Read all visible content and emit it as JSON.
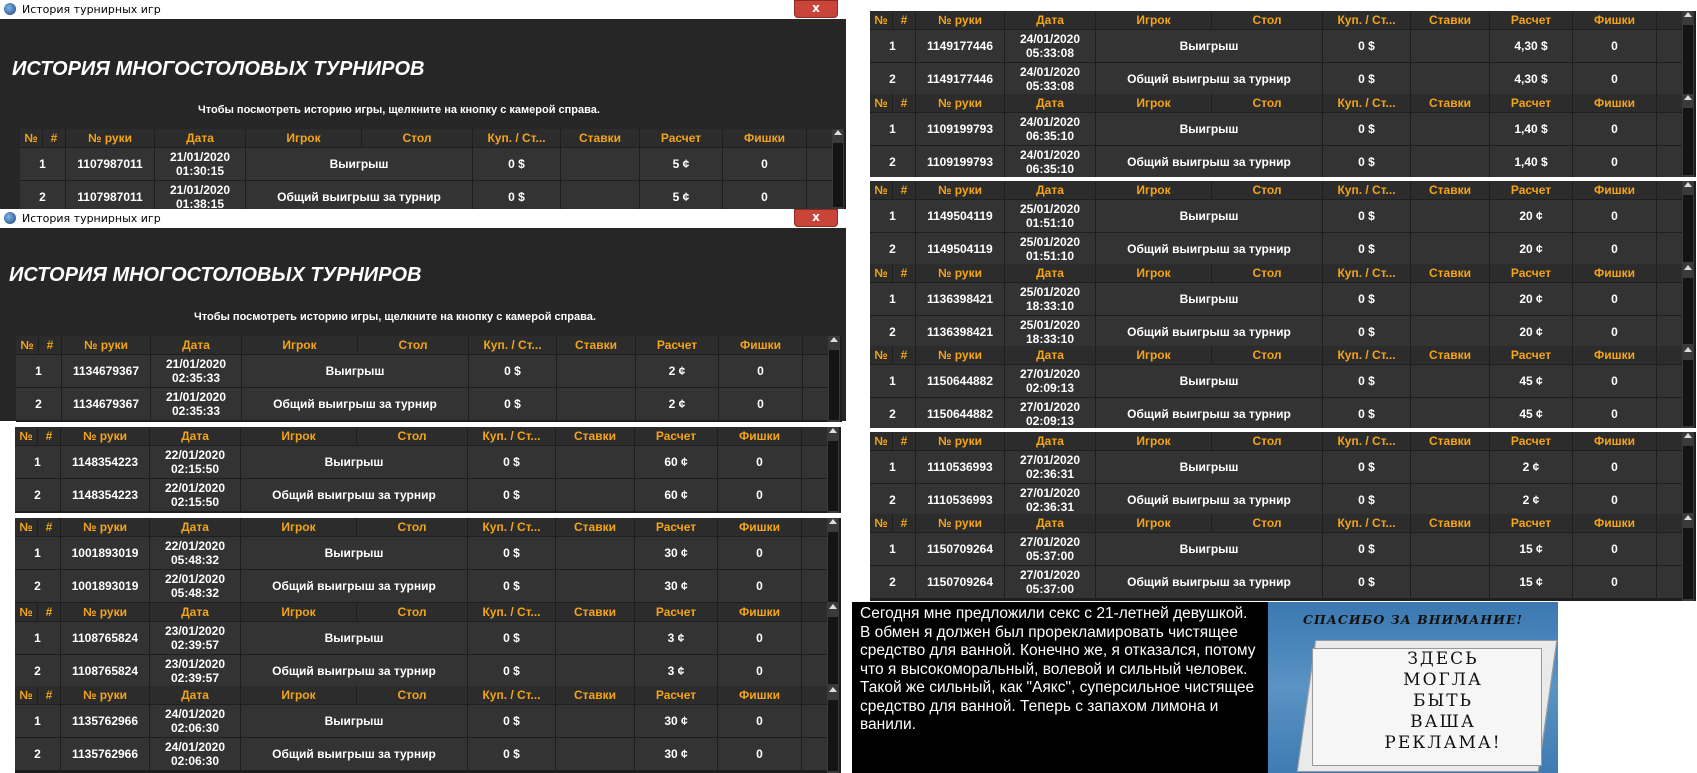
{
  "app": {
    "window_title": "История турнирных игр",
    "close_glyph": "x",
    "heading": "ИСТОРИЯ МНОГОСТОЛОВЫХ ТУРНИРОВ",
    "hint": "Чтобы посмотреть историю игры, щелкните на  кнопку с камерой справа."
  },
  "columns": [
    "№",
    "#",
    "№ руки",
    "Дата",
    "Игрок",
    "Стол",
    "Куп. / Ст...",
    "Ставки",
    "Расчет",
    "Фишки"
  ],
  "row_labels": {
    "win": "Выигрыш",
    "total": "Общий выигрыш за турнир",
    "buyin": "0 $",
    "chips": "0"
  },
  "tables": [
    {
      "hand": "1107987011",
      "date": "21/01/2020",
      "time1": "01:30:15",
      "time2": "01:38:15",
      "amount": "5 ¢"
    },
    {
      "hand": "1134679367",
      "date": "21/01/2020",
      "time1": "02:35:33",
      "time2": "02:35:33",
      "amount": "2 ¢"
    },
    {
      "hand": "1148354223",
      "date": "22/01/2020",
      "time1": "02:15:50",
      "time2": "02:15:50",
      "amount": "60 ¢"
    },
    {
      "hand": "1001893019",
      "date": "22/01/2020",
      "time1": "05:48:32",
      "time2": "05:48:32",
      "amount": "30 ¢"
    },
    {
      "hand": "1108765824",
      "date": "23/01/2020",
      "time1": "02:39:57",
      "time2": "02:39:57",
      "amount": "3 ¢"
    },
    {
      "hand": "1135762966",
      "date": "24/01/2020",
      "time1": "02:06:30",
      "time2": "02:06:30",
      "amount": "30 ¢"
    },
    {
      "hand": "1149177446",
      "date": "24/01/2020",
      "time1": "05:33:08",
      "time2": "05:33:08",
      "amount": "4,30 $"
    },
    {
      "hand": "1109199793",
      "date": "24/01/2020",
      "time1": "06:35:10",
      "time2": "06:35:10",
      "amount": "1,40 $"
    },
    {
      "hand": "1149504119",
      "date": "25/01/2020",
      "time1": "01:51:10",
      "time2": "01:51:10",
      "amount": "20 ¢"
    },
    {
      "hand": "1136398421",
      "date": "25/01/2020",
      "time1": "18:33:10",
      "time2": "18:33:10",
      "amount": "20 ¢"
    },
    {
      "hand": "1150644882",
      "date": "27/01/2020",
      "time1": "02:09:13",
      "time2": "02:09:13",
      "amount": "45 ¢"
    },
    {
      "hand": "1110536993",
      "date": "27/01/2020",
      "time1": "02:36:31",
      "time2": "02:36:31",
      "amount": "2 ¢"
    },
    {
      "hand": "1150709264",
      "date": "27/01/2020",
      "time1": "05:37:00",
      "time2": "05:37:00",
      "amount": "15 ¢"
    }
  ],
  "story": "Сегодня мне предложили секс с 21-летней девушкой. В обмен я должен был прорекламировать чистящее средство для ванной. Конечно же, я отказался, потому что я высокоморальный, волевой и сильный человек. Такой же сильный, как \"Аякс\", суперсильное чистящее средство для ванной. Теперь с запахом лимона и ванили.",
  "ad": {
    "banner": "СПАСИБО ЗА ВНИМАНИЕ!",
    "lines": [
      "ЗДЕСЬ",
      "МОГЛА",
      "БЫТЬ",
      "ВАША",
      "РЕКЛАМА!"
    ]
  }
}
